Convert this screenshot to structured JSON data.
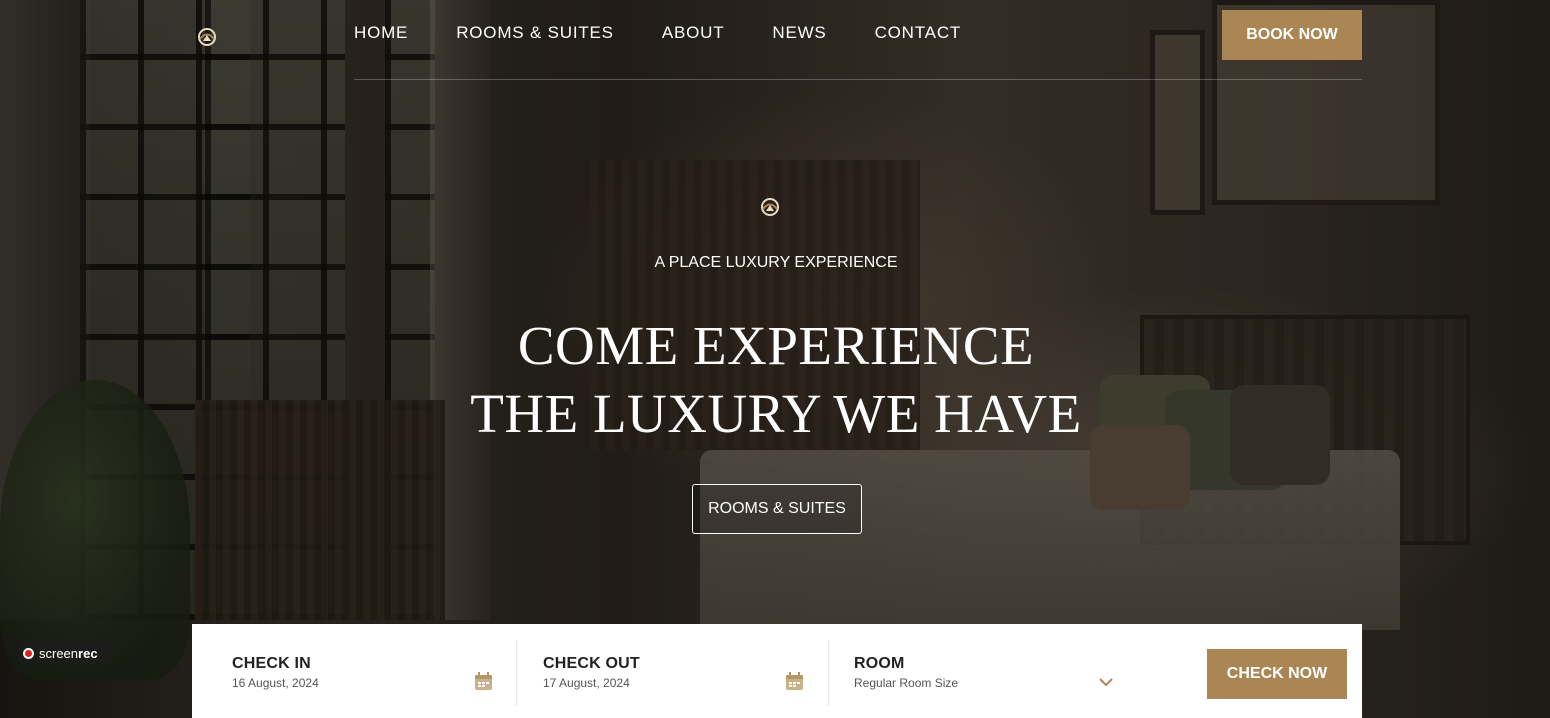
{
  "header": {
    "nav": [
      "HOME",
      "ROOMS & SUITES",
      "ABOUT",
      "NEWS",
      "CONTACT"
    ],
    "book_label": "BOOK NOW"
  },
  "hero": {
    "subtitle": "A PLACE LUXURY EXPERIENCE",
    "headline_line1": "COME EXPERIENCE",
    "headline_line2": "THE LUXURY WE HAVE",
    "button_label": "ROOMS & SUITES"
  },
  "booking": {
    "check_in": {
      "label": "CHECK IN",
      "value": "16 August, 2024"
    },
    "check_out": {
      "label": "CHECK OUT",
      "value": "17 August, 2024"
    },
    "room": {
      "label": "ROOM",
      "value": "Regular Room Size"
    },
    "submit_label": "CHECK NOW"
  },
  "recorder": {
    "brand_light": "screen",
    "brand_bold": "rec"
  },
  "icons": {
    "logo": "hotel-logo-icon",
    "calendar": "calendar-icon",
    "dropdown": "chevron-down-icon",
    "record": "record-dot-icon"
  },
  "colors": {
    "accent": "#a98654",
    "text_light": "#ffffff",
    "text_dark": "#222222"
  }
}
